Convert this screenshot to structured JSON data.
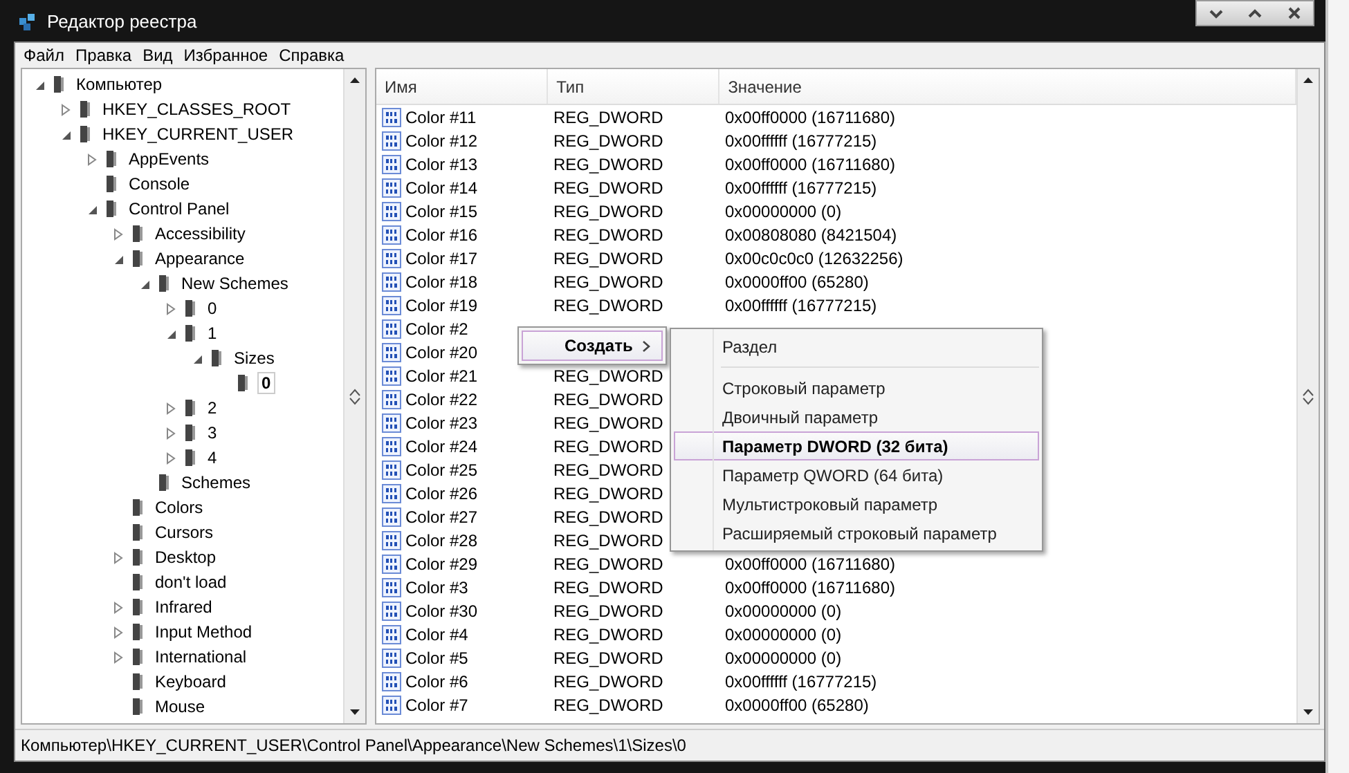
{
  "window": {
    "title": "Редактор реестра"
  },
  "menu": [
    "Файл",
    "Правка",
    "Вид",
    "Избранное",
    "Справка"
  ],
  "tree": [
    {
      "label": "Компьютер",
      "expanded": true,
      "selected": false,
      "children": [
        {
          "label": "HKEY_CLASSES_ROOT",
          "expanded": false,
          "selected": false
        },
        {
          "label": "HKEY_CURRENT_USER",
          "expanded": true,
          "selected": false,
          "children": [
            {
              "label": "AppEvents",
              "expanded": false,
              "selected": false
            },
            {
              "label": "Console",
              "selected": false
            },
            {
              "label": "Control Panel",
              "expanded": true,
              "selected": false,
              "children": [
                {
                  "label": "Accessibility",
                  "expanded": false,
                  "selected": false
                },
                {
                  "label": "Appearance",
                  "expanded": true,
                  "selected": false,
                  "children": [
                    {
                      "label": "New Schemes",
                      "expanded": true,
                      "selected": false,
                      "children": [
                        {
                          "label": "0",
                          "expanded": false,
                          "selected": false
                        },
                        {
                          "label": "1",
                          "expanded": true,
                          "selected": false,
                          "children": [
                            {
                              "label": "Sizes",
                              "expanded": true,
                              "selected": false,
                              "children": [
                                {
                                  "label": "0",
                                  "selected": true
                                }
                              ]
                            }
                          ]
                        },
                        {
                          "label": "2",
                          "expanded": false,
                          "selected": false
                        },
                        {
                          "label": "3",
                          "expanded": false,
                          "selected": false
                        },
                        {
                          "label": "4",
                          "expanded": false,
                          "selected": false
                        }
                      ]
                    },
                    {
                      "label": "Schemes",
                      "selected": false
                    }
                  ]
                },
                {
                  "label": "Colors",
                  "selected": false
                },
                {
                  "label": "Cursors",
                  "selected": false
                },
                {
                  "label": "Desktop",
                  "expanded": false,
                  "selected": false
                },
                {
                  "label": "don't load",
                  "selected": false
                },
                {
                  "label": "Infrared",
                  "expanded": false,
                  "selected": false
                },
                {
                  "label": "Input Method",
                  "expanded": false,
                  "selected": false
                },
                {
                  "label": "International",
                  "expanded": false,
                  "selected": false
                },
                {
                  "label": "Keyboard",
                  "selected": false
                },
                {
                  "label": "Mouse",
                  "selected": false
                }
              ]
            }
          ]
        }
      ]
    }
  ],
  "table": {
    "columns": [
      "Имя",
      "Тип",
      "Значение"
    ],
    "rows": [
      {
        "name": "Color #11",
        "type": "REG_DWORD",
        "value": "0x00ff0000 (16711680)"
      },
      {
        "name": "Color #12",
        "type": "REG_DWORD",
        "value": "0x00ffffff (16777215)"
      },
      {
        "name": "Color #13",
        "type": "REG_DWORD",
        "value": "0x00ff0000 (16711680)"
      },
      {
        "name": "Color #14",
        "type": "REG_DWORD",
        "value": "0x00ffffff (16777215)"
      },
      {
        "name": "Color #15",
        "type": "REG_DWORD",
        "value": "0x00000000 (0)"
      },
      {
        "name": "Color #16",
        "type": "REG_DWORD",
        "value": "0x00808080 (8421504)"
      },
      {
        "name": "Color #17",
        "type": "REG_DWORD",
        "value": "0x00c0c0c0 (12632256)"
      },
      {
        "name": "Color #18",
        "type": "REG_DWORD",
        "value": "0x0000ff00 (65280)"
      },
      {
        "name": "Color #19",
        "type": "REG_DWORD",
        "value": "0x00ffffff (16777215)"
      },
      {
        "name": "Color #2"
      },
      {
        "name": "Color #20"
      },
      {
        "name": "Color #21",
        "type": "REG_DWORD"
      },
      {
        "name": "Color #22",
        "type": "REG_DWORD"
      },
      {
        "name": "Color #23",
        "type": "REG_DWORD"
      },
      {
        "name": "Color #24",
        "type": "REG_DWORD"
      },
      {
        "name": "Color #25",
        "type": "REG_DWORD"
      },
      {
        "name": "Color #26",
        "type": "REG_DWORD"
      },
      {
        "name": "Color #27",
        "type": "REG_DWORD"
      },
      {
        "name": "Color #28",
        "type": "REG_DWORD"
      },
      {
        "name": "Color #29",
        "type": "REG_DWORD",
        "value": "0x00ff0000 (16711680)"
      },
      {
        "name": "Color #3",
        "type": "REG_DWORD",
        "value": "0x00ff0000 (16711680)"
      },
      {
        "name": "Color #30",
        "type": "REG_DWORD",
        "value": "0x00000000 (0)"
      },
      {
        "name": "Color #4",
        "type": "REG_DWORD",
        "value": "0x00000000 (0)"
      },
      {
        "name": "Color #5",
        "type": "REG_DWORD",
        "value": "0x00000000 (0)"
      },
      {
        "name": "Color #6",
        "type": "REG_DWORD",
        "value": "0x00ffffff (16777215)"
      },
      {
        "name": "Color #7",
        "type": "REG_DWORD",
        "value": "0x0000ff00 (65280)"
      }
    ]
  },
  "context_menu": {
    "items": [
      {
        "label": "Создать",
        "selected": true,
        "submenu": true
      }
    ]
  },
  "submenu": {
    "items": [
      {
        "kind": "item",
        "label": "Раздел",
        "selected": false
      },
      {
        "kind": "separator"
      },
      {
        "kind": "item",
        "label": "Строковый параметр",
        "selected": false
      },
      {
        "kind": "item",
        "label": "Двоичный параметр",
        "selected": false
      },
      {
        "kind": "item",
        "label": "Параметр DWORD (32 бита)",
        "selected": true
      },
      {
        "kind": "item",
        "label": "Параметр QWORD (64 бита)",
        "selected": false
      },
      {
        "kind": "item",
        "label": "Мультистроковый параметр",
        "selected": false
      },
      {
        "kind": "item",
        "label": "Расширяемый строковый параметр",
        "selected": false
      }
    ]
  },
  "status_bar": "Компьютер\\HKEY_CURRENT_USER\\Control Panel\\Appearance\\New Schemes\\1\\Sizes\\0"
}
